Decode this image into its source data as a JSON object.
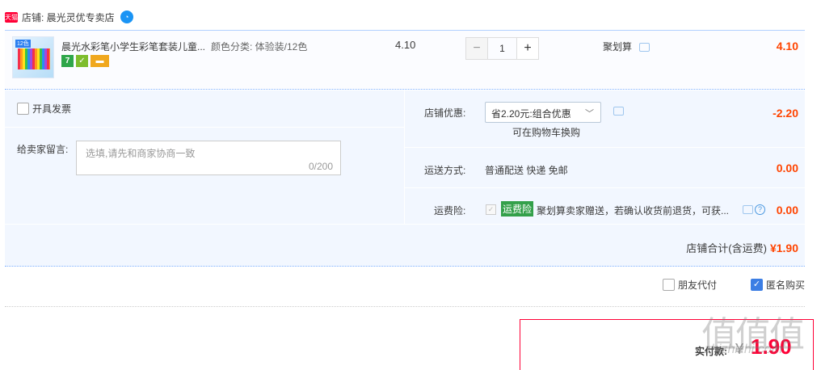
{
  "shop": {
    "badge": "天猫",
    "label": "店铺: 晨光灵优专卖店"
  },
  "item": {
    "thumb_tag": "12色",
    "title": "晨光水彩笔小学生彩笔套装儿童...",
    "sku": "颜色分类: 体验装/12色",
    "price": "4.10",
    "quantity": "1",
    "promo": "聚划算",
    "total": "4.10",
    "badge_seven": "7"
  },
  "invoice_label": "开具发票",
  "memo": {
    "label": "给卖家留言:",
    "placeholder": "选填,请先和商家协商一致",
    "count": "0/200"
  },
  "discount": {
    "label": "店铺优惠:",
    "selected": "省2.20元:组合优惠",
    "note": "可在购物车换购",
    "amount": "-2.20"
  },
  "shipping": {
    "label": "运送方式:",
    "value": "普通配送 快递 免邮",
    "amount": "0.00"
  },
  "insurance": {
    "label": "运费险:",
    "tag": "运费险",
    "text": "聚划算卖家赠送，若确认收货前退货，可获...",
    "amount": "0.00"
  },
  "shop_total": {
    "label": "店铺合计(含运费)",
    "amount": "¥1.90"
  },
  "options": {
    "friend_pay": "朋友代付",
    "anonymous": "匿名购买"
  },
  "payment": {
    "label": "实付款:",
    "currency": "¥",
    "amount": "1.90"
  },
  "watermark": {
    "logo": "值值值",
    "url": "zhizhizhi.com"
  }
}
